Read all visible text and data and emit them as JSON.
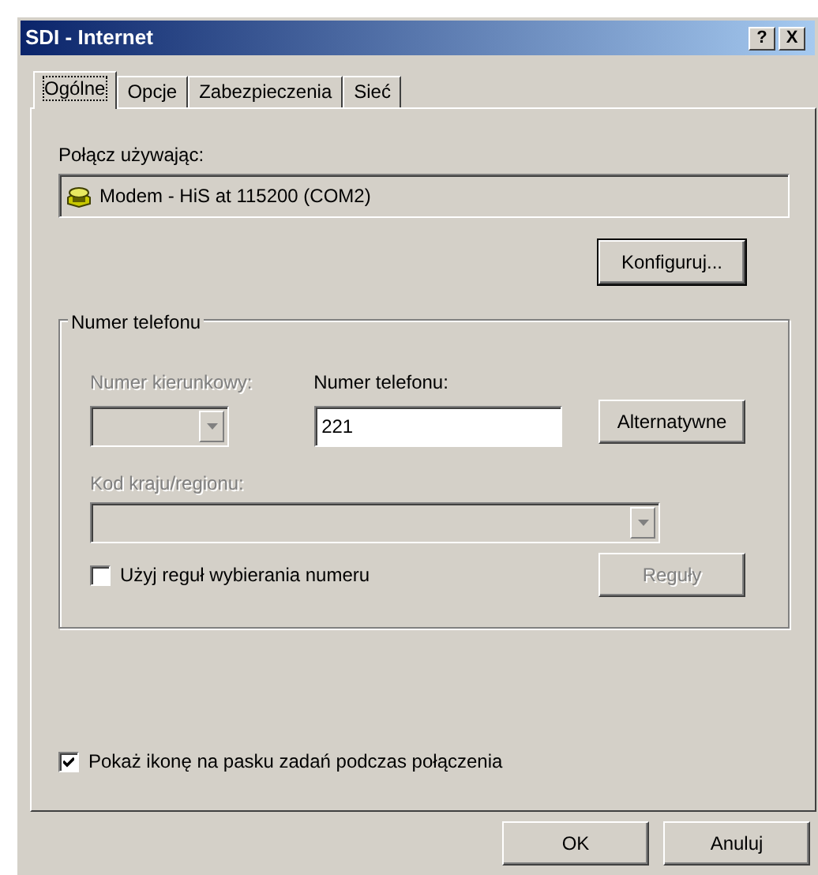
{
  "window": {
    "title": "SDI - Internet",
    "title_buttons": [
      "?",
      "X"
    ]
  },
  "tabs": [
    {
      "label": "Ogólne",
      "selected": true
    },
    {
      "label": "Opcje",
      "selected": false
    },
    {
      "label": "Zabezpieczenia",
      "selected": false
    },
    {
      "label": "Sieć",
      "selected": false
    }
  ],
  "connect_using": {
    "label": "Połącz używając:",
    "device": "Modem - HiS at 115200 (COM2)",
    "configure_button": "Konfiguruj..."
  },
  "phone_group": {
    "legend": "Numer telefonu",
    "area_code": {
      "label": "Numer kierunkowy:",
      "disabled": true
    },
    "phone_number": {
      "label": "Numer telefonu:",
      "value": "221"
    },
    "alternates_button": {
      "label": "Alternatywne",
      "disabled": false
    },
    "country": {
      "label": "Kod kraju/regionu:",
      "disabled": true
    },
    "dialing_rules": {
      "label": "Użyj reguł wybierania numeru",
      "checked": false
    },
    "rules_button": {
      "label": "Reguły",
      "disabled": true
    }
  },
  "show_icon": {
    "label": "Pokaż ikonę na pasku zadań podczas połączenia",
    "checked": true
  },
  "buttons": [
    "OK",
    "Anuluj"
  ]
}
